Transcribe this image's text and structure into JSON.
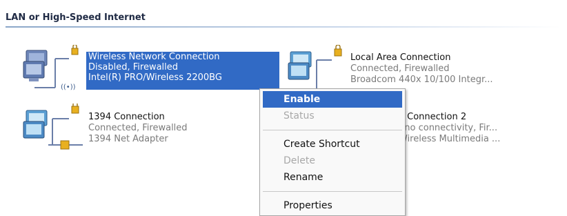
{
  "group": {
    "title": "LAN or High-Speed Internet"
  },
  "connections": [
    {
      "name": "Wireless Network Connection",
      "status": "Disabled, Firewalled",
      "device": "Intel(R) PRO/Wireless 2200BG",
      "icon": "wireless-network-icon"
    },
    {
      "name": "Local Area Connection",
      "status": "Connected, Firewalled",
      "device": "Broadcom 440x 10/100 Integr...",
      "icon": "network-connection-icon"
    },
    {
      "name": "1394 Connection",
      "status": "Connected, Firewalled",
      "device": "1394 Net Adapter",
      "icon": "network-connection-icon"
    },
    {
      "name": "e Connection 2",
      "status": ", no connectivity, Fir...",
      "device": "Wireless Multimedia ...",
      "icon": "network-connection-icon"
    }
  ],
  "context_menu": {
    "items": [
      {
        "label": "Enable",
        "state": "default"
      },
      {
        "label": "Status",
        "state": "disabled"
      },
      {
        "label": "Create Shortcut",
        "state": "normal"
      },
      {
        "label": "Delete",
        "state": "disabled"
      },
      {
        "label": "Rename",
        "state": "normal"
      },
      {
        "label": "Properties",
        "state": "normal"
      }
    ]
  },
  "colors": {
    "selection": "#316ac5",
    "lock": "#e8b020"
  }
}
